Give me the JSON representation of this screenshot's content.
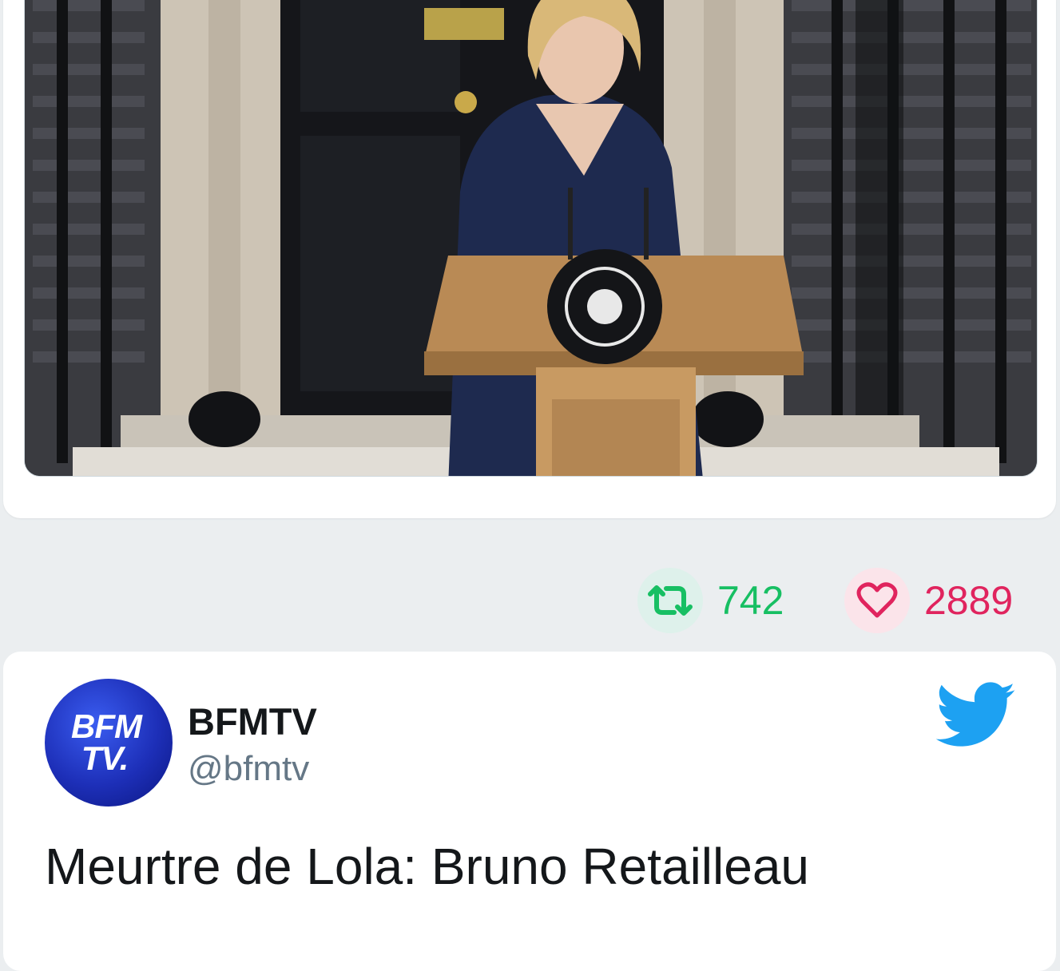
{
  "previous_tweet": {
    "media_description": "photo",
    "retweet_count": "742",
    "like_count": "2889"
  },
  "tweet": {
    "author_name": "BFMTV",
    "author_handle": "@bfmtv",
    "avatar_text_line1": "BFM",
    "avatar_text_line2": "TV.",
    "text": "Meurtre de Lola: Bruno Retailleau"
  },
  "colors": {
    "retweet": "#17bf63",
    "like": "#e0245e",
    "twitter_blue": "#1da1f2",
    "page_bg": "#ebeef0"
  },
  "icons": [
    "retweet-icon",
    "heart-icon",
    "twitter-bird-icon"
  ]
}
